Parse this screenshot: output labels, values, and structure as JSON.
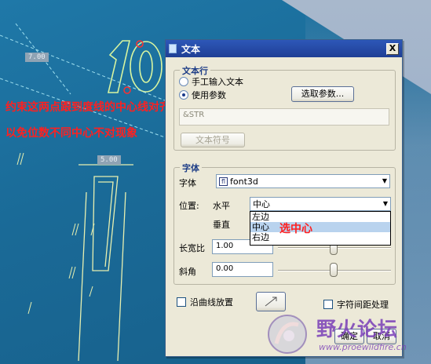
{
  "viewport": {
    "annotations": {
      "line1": "约束这两点跟到度线的中心线对齐",
      "line2": "以免位数不同中心不对现象",
      "select_center": "选中心"
    },
    "dim_tags": [
      "7.00",
      "5.00"
    ]
  },
  "dialog": {
    "title": "文本",
    "close_label": "X",
    "text_line": {
      "legend": "文本行",
      "manual_label": "手工输入文本",
      "use_param_label": "使用参数",
      "select_param_button": "选取参数...",
      "param_value": "&STR",
      "text_symbol_button": "文本符号"
    },
    "font": {
      "legend": "字体",
      "font_label": "字体",
      "font_value": "font3d",
      "position_label": "位置:",
      "horizontal_label": "水平",
      "horizontal_value": "中心",
      "vertical_label": "垂直",
      "dropdown_options": [
        "左边",
        "中心",
        "右边"
      ],
      "aspect_label": "长宽比",
      "aspect_value": "1.00",
      "slant_label": "斜角",
      "slant_value": "0.00",
      "along_curve_label": "沿曲线放置",
      "kerning_label": "字符间距处理"
    },
    "ok_button": "确定",
    "cancel_button": "取消"
  },
  "watermark": {
    "text": "野火论坛",
    "url": "www.proewildfire.cn"
  },
  "colors": {
    "annotation": "#ff2020",
    "titlebar": "#2d57b8",
    "dialog_bg": "#ece9d8",
    "viewport_bg": "#1d6e9a"
  }
}
